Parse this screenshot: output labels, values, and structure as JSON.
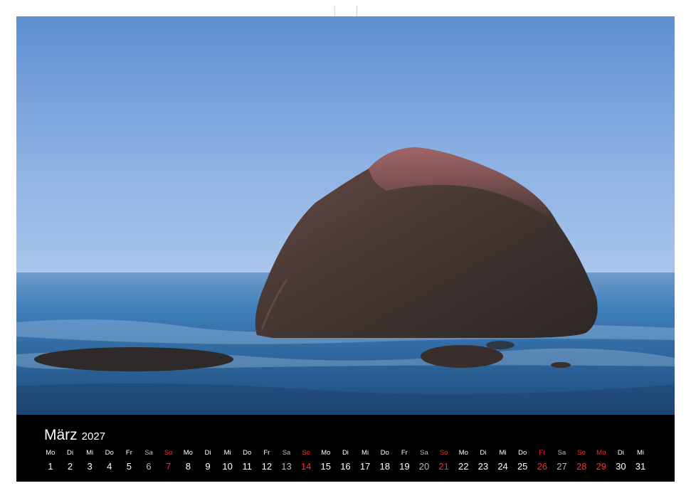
{
  "calendar": {
    "month": "März",
    "year": "2027",
    "days": [
      {
        "dow": "Mo",
        "day": "1",
        "kind": "normal"
      },
      {
        "dow": "Di",
        "day": "2",
        "kind": "normal"
      },
      {
        "dow": "Mi",
        "day": "3",
        "kind": "normal"
      },
      {
        "dow": "Do",
        "day": "4",
        "kind": "normal"
      },
      {
        "dow": "Fr",
        "day": "5",
        "kind": "normal"
      },
      {
        "dow": "Sa",
        "day": "6",
        "kind": "sat"
      },
      {
        "dow": "So",
        "day": "7",
        "kind": "red"
      },
      {
        "dow": "Mo",
        "day": "8",
        "kind": "normal"
      },
      {
        "dow": "Di",
        "day": "9",
        "kind": "normal"
      },
      {
        "dow": "Mi",
        "day": "10",
        "kind": "normal"
      },
      {
        "dow": "Do",
        "day": "11",
        "kind": "normal"
      },
      {
        "dow": "Fr",
        "day": "12",
        "kind": "normal"
      },
      {
        "dow": "Sa",
        "day": "13",
        "kind": "sat"
      },
      {
        "dow": "So",
        "day": "14",
        "kind": "red"
      },
      {
        "dow": "Mo",
        "day": "15",
        "kind": "normal"
      },
      {
        "dow": "Di",
        "day": "16",
        "kind": "normal"
      },
      {
        "dow": "Mi",
        "day": "17",
        "kind": "normal"
      },
      {
        "dow": "Do",
        "day": "18",
        "kind": "normal"
      },
      {
        "dow": "Fr",
        "day": "19",
        "kind": "normal"
      },
      {
        "dow": "Sa",
        "day": "20",
        "kind": "sat"
      },
      {
        "dow": "So",
        "day": "21",
        "kind": "red"
      },
      {
        "dow": "Mo",
        "day": "22",
        "kind": "normal"
      },
      {
        "dow": "Di",
        "day": "23",
        "kind": "normal"
      },
      {
        "dow": "Mi",
        "day": "24",
        "kind": "normal"
      },
      {
        "dow": "Do",
        "day": "25",
        "kind": "normal"
      },
      {
        "dow": "Fr",
        "day": "26",
        "kind": "red"
      },
      {
        "dow": "Sa",
        "day": "27",
        "kind": "sat"
      },
      {
        "dow": "So",
        "day": "28",
        "kind": "red"
      },
      {
        "dow": "Mo",
        "day": "29",
        "kind": "red"
      },
      {
        "dow": "Di",
        "day": "30",
        "kind": "normal"
      },
      {
        "dow": "Mi",
        "day": "31",
        "kind": "normal"
      }
    ]
  },
  "colors": {
    "holiday": "#ff2a2a",
    "saturday": "#bbbbbb",
    "panel": "#000000"
  }
}
